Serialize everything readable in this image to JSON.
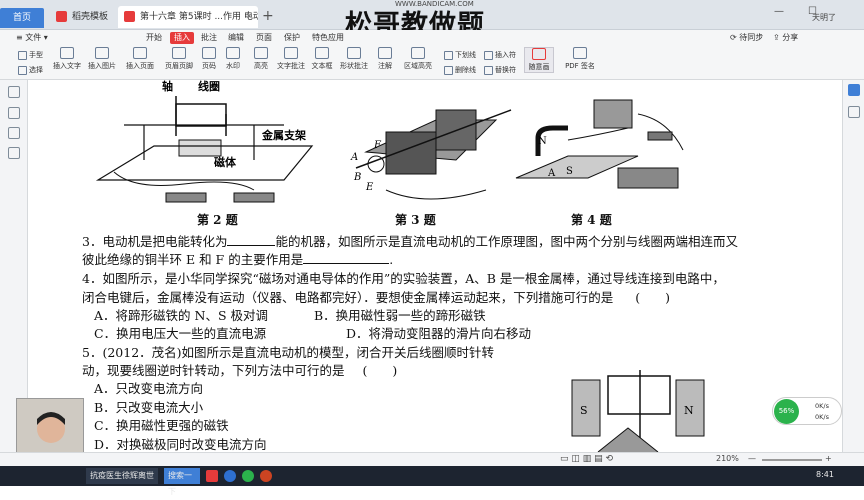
{
  "tabs": [
    {
      "label": "首页"
    },
    {
      "label": "稻壳模板"
    },
    {
      "label": "第十六章 第5课时 ...作用 电动机.pdf"
    }
  ],
  "watermark": {
    "url": "WWW.BANDICAM.COM",
    "title": "松哥教做题"
  },
  "window": {
    "user": "天明了"
  },
  "menu": {
    "file": "文件",
    "items": [
      "开始",
      "插入",
      "批注",
      "编辑",
      "页面",
      "保护",
      "特色应用"
    ],
    "right": [
      "待同步",
      "分享"
    ]
  },
  "tools": [
    {
      "label": "手型",
      "icon": "hand-icon"
    },
    {
      "label": "选择",
      "icon": "cursor-icon"
    },
    {
      "label": "插入文字",
      "icon": "text-insert-icon"
    },
    {
      "label": "插入图片",
      "icon": "image-icon"
    },
    {
      "label": "插入页面",
      "icon": "page-insert-icon"
    },
    {
      "label": "页眉页脚",
      "icon": "header-footer-icon"
    },
    {
      "label": "页码",
      "icon": "page-number-icon"
    },
    {
      "label": "水印",
      "icon": "watermark-icon"
    },
    {
      "label": "高亮",
      "icon": "highlight-icon"
    },
    {
      "label": "文字批注",
      "icon": "text-comment-icon"
    },
    {
      "label": "文本框",
      "icon": "textbox-icon"
    },
    {
      "label": "形状批注",
      "icon": "shape-comment-icon"
    },
    {
      "label": "注解",
      "icon": "note-icon"
    },
    {
      "label": "区域高亮",
      "icon": "area-highlight-icon"
    },
    {
      "label": "下划线",
      "icon": "underline-icon"
    },
    {
      "label": "删除线",
      "icon": "strikethrough-icon"
    },
    {
      "label": "插入符",
      "icon": "caret-icon"
    },
    {
      "label": "替换符",
      "icon": "replace-icon"
    },
    {
      "label": "随意画",
      "icon": "freehand-icon"
    },
    {
      "label": "PDF 签名",
      "icon": "signature-icon"
    }
  ],
  "figures": {
    "fig2": {
      "caption": "第 2 题",
      "labels": [
        "轴",
        "线圈",
        "金属支架",
        "磁体"
      ]
    },
    "fig3": {
      "caption": "第 3 题",
      "labels": [
        "A",
        "B",
        "F",
        "E"
      ]
    },
    "fig4": {
      "caption": "第 4 题",
      "labels": [
        "N",
        "S",
        "A"
      ]
    },
    "fig5": {
      "labels": [
        "S",
        "N"
      ]
    }
  },
  "text": {
    "q3a": "3．电动机是把电能转化为",
    "q3b": "能的机器，如图所示是直流电动机的工作原理图，图中两个分别与线圈两端相连而又",
    "q3c": "彼此绝缘的铜半环 E 和 F 的主要作用是",
    "q3d": ".",
    "q4a": "4．如图所示，是小华同学探究“磁场对通电导体的作用”的实验装置，A、B 是一根金属棒，通过导线连接到电路中，",
    "q4b": "闭合电键后，金属棒没有运动（仪器、电路都完好）．要想使金属棒运动起来，下列措施可行的是",
    "q4bracket": "(　　)",
    "q4A": "A．将蹄形磁铁的 N、S 极对调",
    "q4B": "B．换用磁性弱一些的蹄形磁铁",
    "q4C": "C．换用电压大一些的直流电源",
    "q4D": "D．将滑动变阻器的滑片向右移动",
    "q5a": "5．(2012．茂名)如图所示是直流电动机的模型，闭合开关后线圈顺时针转",
    "q5b": "动，现要线圈逆时针转动，下列方法中可行的是",
    "q5bracket": "(　　)",
    "q5A": "A．只改变电流方向",
    "q5B": "B．只改变电流大小",
    "q5C": "C．换用磁性更强的磁铁",
    "q5D": "D．对换磁极同时改变电流方向"
  },
  "status": {
    "zoom": "210%"
  },
  "network": {
    "percent": "56%",
    "up": "0K/s",
    "down": "0K/s"
  },
  "taskbar": {
    "items": [
      "抗疫医生徐辉离世",
      "搜索一下"
    ],
    "time": "8:41"
  },
  "colors": {
    "accent": "#e63b3b",
    "tab_active": "#3f7fd6",
    "taskbar": "#1d2430"
  }
}
